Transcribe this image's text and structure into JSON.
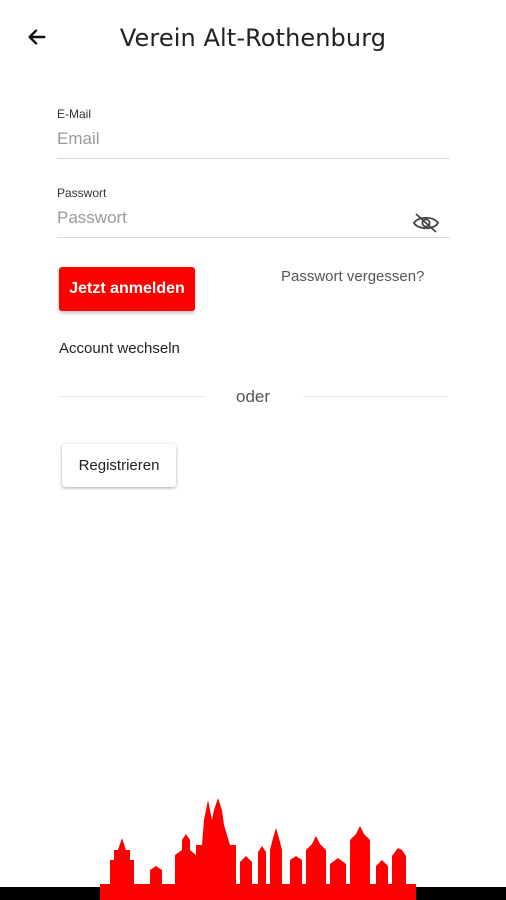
{
  "header": {
    "title": "Verein Alt-Rothenburg",
    "back_icon": "arrow-left-icon"
  },
  "form": {
    "email": {
      "label": "E-Mail",
      "placeholder": "Email",
      "value": ""
    },
    "password": {
      "label": "Passwort",
      "placeholder": "Passwort",
      "value": "",
      "toggle_icon": "eye-off-icon"
    }
  },
  "actions": {
    "login_label": "Jetzt anmelden",
    "forgot_label": "Passwort vergessen?",
    "switch_account_label": "Account wechseln",
    "separator_label": "oder",
    "register_label": "Registrieren"
  },
  "colors": {
    "brand": "#ff0000",
    "background": "#ffffff",
    "footer_bar": "#000000"
  },
  "footer": {
    "image": "city-skyline-illustration"
  }
}
